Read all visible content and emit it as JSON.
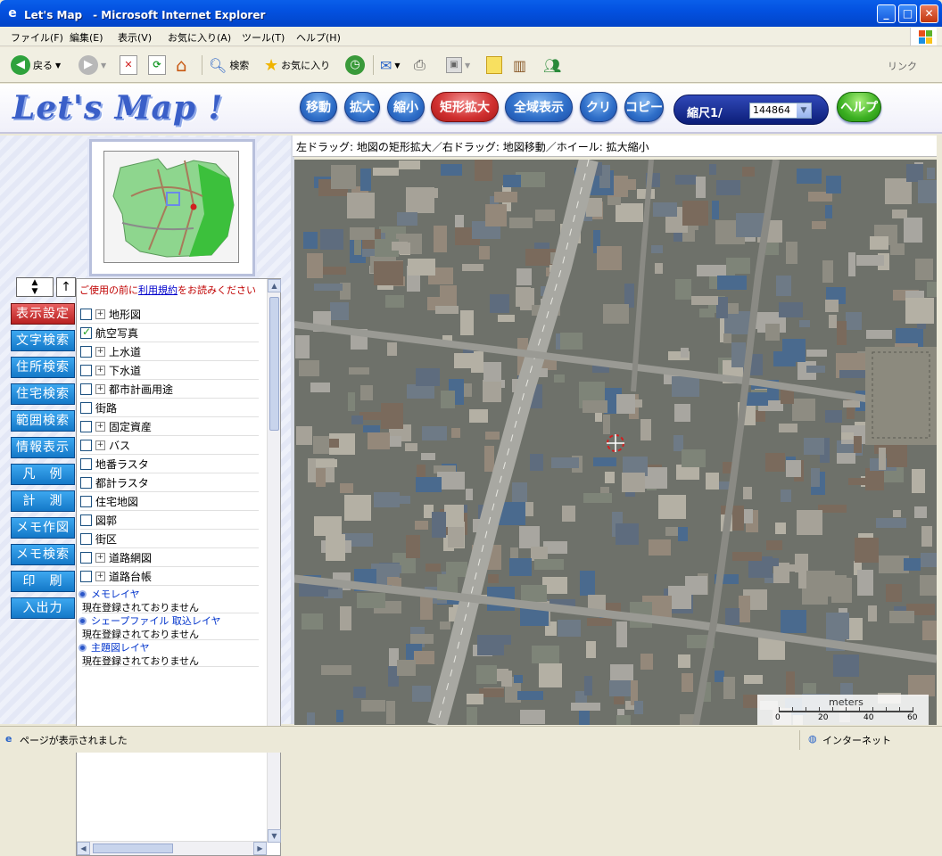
{
  "window": {
    "title": "Let's Map　- Microsoft Internet Explorer",
    "min": "_",
    "max": "□",
    "close": "✕"
  },
  "menu": [
    "ファイル(F)",
    "編集(E)",
    "表示(V)",
    "お気に入り(A)",
    "ツール(T)",
    "ヘルプ(H)"
  ],
  "toolbar": {
    "back": "戻る",
    "search": "検索",
    "favorites": "お気に入り",
    "links": "リンク"
  },
  "app": {
    "logo": "Let's Map !",
    "buttons": [
      {
        "label": "移動"
      },
      {
        "label": "拡大"
      },
      {
        "label": "縮小"
      },
      {
        "label": "矩形拡大",
        "active": true
      },
      {
        "label": "全域表示"
      },
      {
        "label": "クリア"
      },
      {
        "label": "コピー"
      }
    ],
    "scale": {
      "label": "縮尺1/",
      "value": "144864"
    },
    "help": "ヘルプ",
    "instructions": "左ドラッグ: 地図の矩形拡大／右ドラッグ: 地図移動／ホイール: 拡大縮小"
  },
  "side_buttons": [
    {
      "label": "表示設定",
      "active": true
    },
    {
      "label": "文字検索"
    },
    {
      "label": "住所検索"
    },
    {
      "label": "住宅検索"
    },
    {
      "label": "範囲検索"
    },
    {
      "label": "情報表示"
    },
    {
      "label": "凡　例"
    },
    {
      "label": "計　測"
    },
    {
      "label": "メモ作図"
    },
    {
      "label": "メモ検索"
    },
    {
      "label": "印　刷"
    },
    {
      "label": "入出力"
    }
  ],
  "panel": {
    "notice_pre": "ご使用の前に",
    "notice_link": "利用規約",
    "notice_post": "をお読みください",
    "layers": [
      {
        "label": "地形図",
        "checked": false,
        "expand": true
      },
      {
        "label": "航空写真",
        "checked": true,
        "expand": false
      },
      {
        "label": "上水道",
        "checked": false,
        "expand": true
      },
      {
        "label": "下水道",
        "checked": false,
        "expand": true
      },
      {
        "label": " 都市計画用途",
        "checked": false,
        "expand": true
      },
      {
        "label": "街路",
        "checked": false,
        "expand": false
      },
      {
        "label": "固定資産",
        "checked": false,
        "expand": true
      },
      {
        "label": " バス",
        "checked": false,
        "expand": true
      },
      {
        "label": "地番ラスタ",
        "checked": false,
        "expand": false
      },
      {
        "label": "都計ラスタ",
        "checked": false,
        "expand": false
      },
      {
        "label": "住宅地図",
        "checked": false,
        "expand": false
      },
      {
        "label": "図郭",
        "checked": false,
        "expand": false
      },
      {
        "label": "街区",
        "checked": false,
        "expand": false
      },
      {
        "label": " 道路網図",
        "checked": false,
        "expand": true
      },
      {
        "label": "道路台帳",
        "checked": false,
        "expand": true
      }
    ],
    "sections": [
      {
        "title": "メモレイヤ",
        "empty": "現在登録されておりません"
      },
      {
        "title": "シェープファイル 取込レイヤ",
        "empty": "現在登録されておりません"
      },
      {
        "title": "主題図レイヤ",
        "empty": "現在登録されておりません"
      }
    ]
  },
  "scalebar": {
    "unit": "meters",
    "ticks": [
      "0",
      "20",
      "40",
      "60"
    ]
  },
  "status": {
    "left": "ページが表示されました",
    "right": "インターネット"
  }
}
